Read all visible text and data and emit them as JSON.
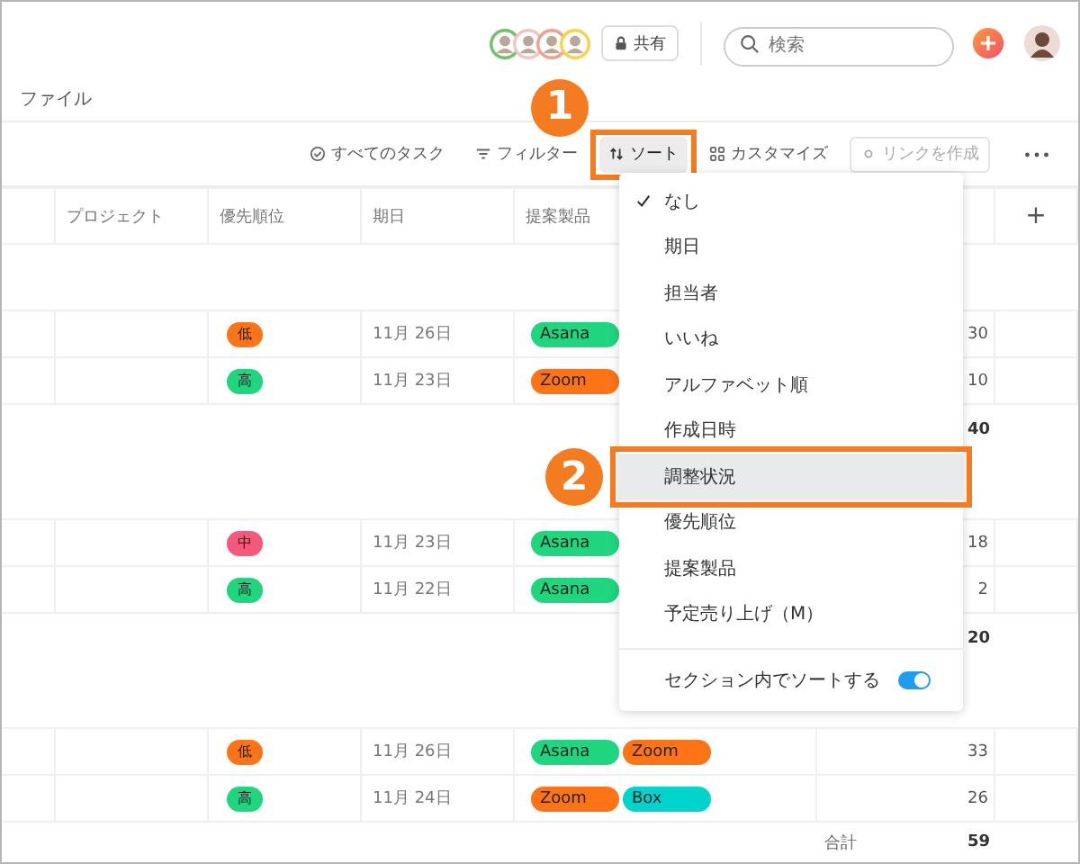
{
  "header": {
    "avatars": [
      {
        "color": "#6cc36a"
      },
      {
        "color": "#f0c7c0"
      },
      {
        "color": "#f3a08a"
      },
      {
        "color": "#f5d34a"
      }
    ],
    "share_button": "共有",
    "search": {
      "placeholder": "検索"
    }
  },
  "breadcrumb": "ファイル",
  "toolbar": [
    {
      "kind": "check",
      "label": "すべてのタスク",
      "selected": false,
      "disabled": false
    },
    {
      "kind": "filter",
      "label": "フィルター",
      "selected": false,
      "disabled": false
    },
    {
      "kind": "sort",
      "label": "ソート",
      "selected": true,
      "disabled": false,
      "annotation": "1"
    },
    {
      "kind": "grid",
      "label": "カスタマイズ",
      "selected": false,
      "disabled": false
    },
    {
      "kind": "link",
      "label": "リンクを作成",
      "selected": false,
      "disabled": true
    }
  ],
  "table": {
    "columns": [
      "プロジェクト",
      "優先順位",
      "期日",
      "提案製品"
    ],
    "add_column": "+",
    "sections": [
      {
        "rows": [
          {
            "priority": {
              "label": "低",
              "color": "#fd7416"
            },
            "due": "11月 26日",
            "products": [
              {
                "label": "Asana",
                "color": "#1fd67f"
              }
            ],
            "amount": "30"
          },
          {
            "priority": {
              "label": "高",
              "color": "#1fd67f"
            },
            "due": "11月 23日",
            "products": [
              {
                "label": "Zoom",
                "color": "#fd7416"
              }
            ],
            "amount": "10"
          }
        ],
        "total": "40"
      },
      {
        "rows": [
          {
            "priority": {
              "label": "中",
              "color": "#f4587a"
            },
            "due": "11月 23日",
            "products": [
              {
                "label": "Asana",
                "color": "#1fd67f"
              }
            ],
            "amount": "18"
          },
          {
            "priority": {
              "label": "高",
              "color": "#1fd67f"
            },
            "due": "11月 22日",
            "products": [
              {
                "label": "Asana",
                "color": "#1fd67f"
              }
            ],
            "amount": "2"
          }
        ],
        "total": "20"
      },
      {
        "rows": [
          {
            "priority": {
              "label": "低",
              "color": "#fd7416"
            },
            "due": "11月 26日",
            "products": [
              {
                "label": "Asana",
                "color": "#1fd67f"
              },
              {
                "label": "Zoom",
                "color": "#fd7416"
              }
            ],
            "amount": "33"
          },
          {
            "priority": {
              "label": "高",
              "color": "#1fd67f"
            },
            "due": "11月 24日",
            "products": [
              {
                "label": "Zoom",
                "color": "#fd7416"
              },
              {
                "label": "Box",
                "color": "#00d4cc"
              }
            ],
            "amount": "26"
          }
        ]
      }
    ],
    "grand_total": {
      "label": "合計",
      "value": "59"
    }
  },
  "sort_menu": {
    "items": [
      {
        "label": "なし",
        "checked": true,
        "selected": false
      },
      {
        "label": "期日",
        "checked": false,
        "selected": false
      },
      {
        "label": "担当者",
        "checked": false,
        "selected": false
      },
      {
        "label": "いいね",
        "checked": false,
        "selected": false
      },
      {
        "label": "アルファベット順",
        "checked": false,
        "selected": false
      },
      {
        "label": "作成日時",
        "checked": false,
        "selected": false
      },
      {
        "label": "調整状況",
        "checked": false,
        "selected": true,
        "annotation": "2"
      },
      {
        "label": "優先順位",
        "checked": false,
        "selected": false
      },
      {
        "label": "提案製品",
        "checked": false,
        "selected": false
      },
      {
        "label": "予定売り上げ（M）",
        "checked": false,
        "selected": false
      }
    ],
    "toggle": {
      "label": "セクション内でソートする",
      "on": true
    }
  }
}
